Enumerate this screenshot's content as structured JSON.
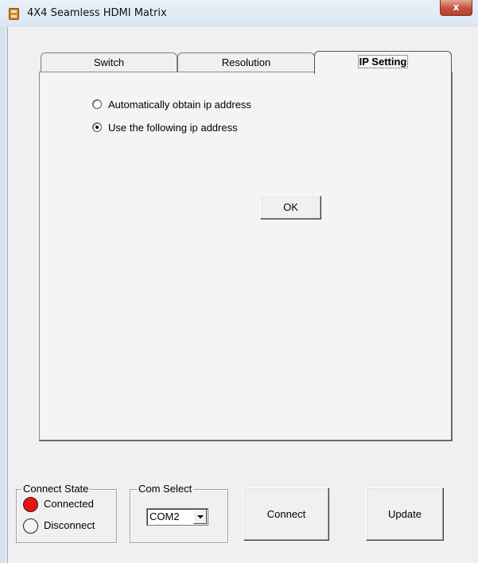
{
  "window": {
    "title": "4X4 Seamless HDMI Matrix",
    "close_glyph": "x"
  },
  "tabs": [
    {
      "label": "Switch",
      "selected": false
    },
    {
      "label": "Resolution",
      "selected": false
    },
    {
      "label": "IP Setting",
      "selected": true
    }
  ],
  "ip_setting": {
    "options": [
      {
        "label": "Automatically obtain ip address",
        "checked": false
      },
      {
        "label": "Use the following ip address",
        "checked": true
      }
    ],
    "ok_label": "OK"
  },
  "connect_state": {
    "legend": "Connect State",
    "connected_label": "Connected",
    "disconnected_label": "Disconnect",
    "connected_color": "#ee1111"
  },
  "com_select": {
    "legend": "Com Select",
    "value": "COM2"
  },
  "buttons": {
    "connect_label": "Connect",
    "update_label": "Update"
  }
}
